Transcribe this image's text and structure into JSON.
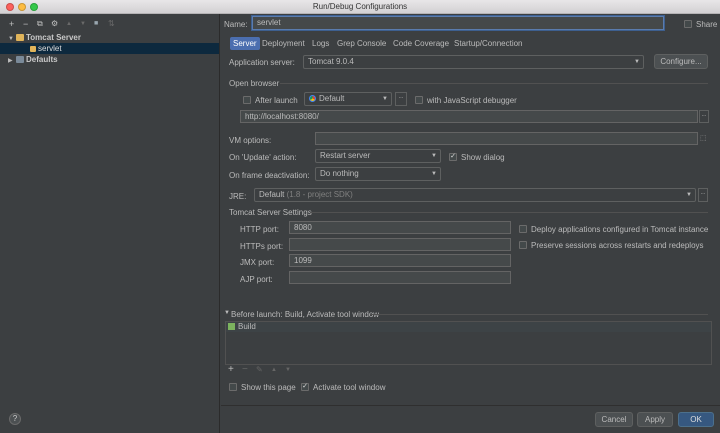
{
  "window": {
    "title": "Run/Debug Configurations"
  },
  "toolbar": {
    "add": "+",
    "remove": "−",
    "copy": "⧉",
    "settings": "⚙",
    "up": "▲",
    "down": "▼",
    "folder": "■",
    "sort": "⇅"
  },
  "tree": {
    "items": [
      {
        "label": "Tomcat Server",
        "expanded": true
      },
      {
        "label": "servlet",
        "selected": true
      },
      {
        "label": "Defaults",
        "expanded": false
      }
    ]
  },
  "name": {
    "label": "Name:",
    "value": "servlet"
  },
  "share": {
    "label": "Share",
    "checked": false
  },
  "tabs": [
    "Server",
    "Deployment",
    "Logs",
    "Grep Console",
    "Code Coverage",
    "Startup/Connection"
  ],
  "active_tab": "Server",
  "app_server": {
    "label": "Application server:",
    "value": "Tomcat 9.0.4",
    "configure": "Configure..."
  },
  "open_browser": {
    "section": "Open browser",
    "after_launch": {
      "label": "After launch",
      "checked": false
    },
    "browser": "Default",
    "js_debugger": {
      "label": "with JavaScript debugger",
      "checked": false
    },
    "url": "http://localhost:8080/"
  },
  "vm_options": {
    "label": "VM options:",
    "value": ""
  },
  "on_update": {
    "label": "On 'Update' action:",
    "value": "Restart server",
    "show_dialog": {
      "label": "Show dialog",
      "checked": true
    }
  },
  "on_frame": {
    "label": "On frame deactivation:",
    "value": "Do nothing"
  },
  "jre": {
    "label": "JRE:",
    "value": "Default",
    "hint": "(1.8 - project SDK)"
  },
  "tomcat_settings": {
    "section": "Tomcat Server Settings",
    "http": {
      "label": "HTTP port:",
      "value": "8080"
    },
    "https": {
      "label": "HTTPs port:",
      "value": ""
    },
    "jmx": {
      "label": "JMX port:",
      "value": "1099"
    },
    "ajp": {
      "label": "AJP port:",
      "value": ""
    },
    "deploy": {
      "label": "Deploy applications configured in Tomcat instance",
      "checked": false
    },
    "preserve": {
      "label": "Preserve sessions across restarts and redeploys",
      "checked": false
    }
  },
  "before_launch": {
    "header": "Before launch: Build, Activate tool window",
    "items": [
      "Build"
    ],
    "show_page": {
      "label": "Show this page",
      "checked": false
    },
    "activate": {
      "label": "Activate tool window",
      "checked": true
    }
  },
  "buttons": {
    "help": "?",
    "cancel": "Cancel",
    "apply": "Apply",
    "ok": "OK"
  },
  "dots": "..."
}
